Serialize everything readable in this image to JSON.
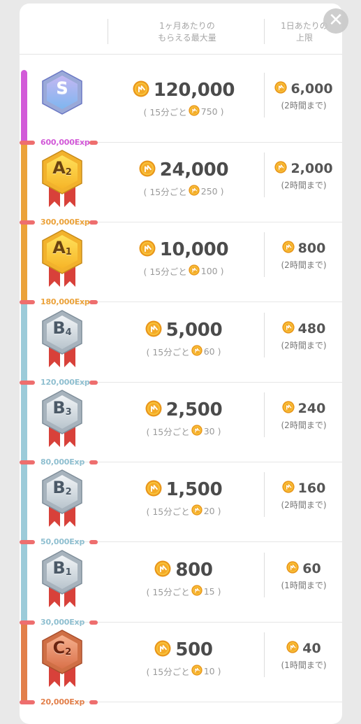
{
  "header": {
    "col1_line1": "1ヶ月あたりの",
    "col1_line2": "もらえる最大量",
    "col2_line1": "1日あたりの",
    "col2_line2": "上限",
    "close_symbol": "✕"
  },
  "colors": {
    "S": "#d25ad8",
    "A": "#eba23a",
    "B": "#9ccbd9",
    "C": "#e27f4a",
    "tick": "#ee6e6e"
  },
  "rows": [
    {
      "rank": "S",
      "sub": "",
      "color": "#d25ad8",
      "exp": "600,000Exp",
      "monthly": "120,000",
      "per15_prefix": "( 15分ごと",
      "per15": "750",
      "per15_suffix": ")",
      "daily": "6,000",
      "limit": "(2時間まで)"
    },
    {
      "rank": "A",
      "sub": "2",
      "color": "#eba23a",
      "exp": "300,000Exp",
      "monthly": "24,000",
      "per15_prefix": "( 15分ごと",
      "per15": "250",
      "per15_suffix": ")",
      "daily": "2,000",
      "limit": "(2時間まで)"
    },
    {
      "rank": "A",
      "sub": "1",
      "color": "#eba23a",
      "exp": "180,000Exp",
      "monthly": "10,000",
      "per15_prefix": "( 15分ごと",
      "per15": "100",
      "per15_suffix": ")",
      "daily": "800",
      "limit": "(2時間まで)"
    },
    {
      "rank": "B",
      "sub": "4",
      "color": "#8fbfd0",
      "exp": "120,000Exp",
      "monthly": "5,000",
      "per15_prefix": "( 15分ごと",
      "per15": "60",
      "per15_suffix": ")",
      "daily": "480",
      "limit": "(2時間まで)"
    },
    {
      "rank": "B",
      "sub": "3",
      "color": "#8fbfd0",
      "exp": "80,000Exp",
      "monthly": "2,500",
      "per15_prefix": "( 15分ごと",
      "per15": "30",
      "per15_suffix": ")",
      "daily": "240",
      "limit": "(2時間まで)"
    },
    {
      "rank": "B",
      "sub": "2",
      "color": "#8fbfd0",
      "exp": "50,000Exp",
      "monthly": "1,500",
      "per15_prefix": "( 15分ごと",
      "per15": "20",
      "per15_suffix": ")",
      "daily": "160",
      "limit": "(2時間まで)"
    },
    {
      "rank": "B",
      "sub": "1",
      "color": "#8fbfd0",
      "exp": "30,000Exp",
      "monthly": "800",
      "per15_prefix": "( 15分ごと",
      "per15": "15",
      "per15_suffix": ")",
      "daily": "60",
      "limit": "(1時間まで)"
    },
    {
      "rank": "C",
      "sub": "2",
      "color": "#e27f4a",
      "exp": "20,000Exp",
      "monthly": "500",
      "per15_prefix": "( 15分ごと",
      "per15": "10",
      "per15_suffix": ")",
      "daily": "40",
      "limit": "(1時間まで)"
    }
  ]
}
